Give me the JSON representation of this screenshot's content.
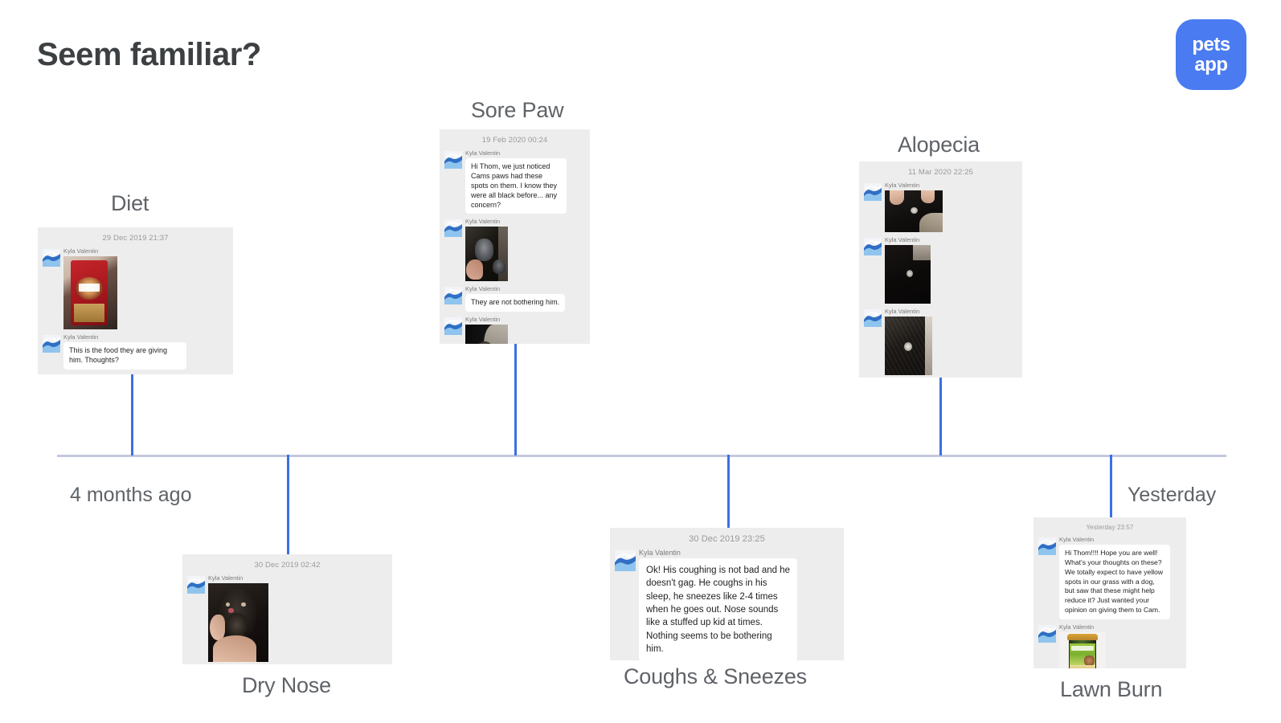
{
  "page": {
    "title": "Seem familiar?"
  },
  "logo": {
    "line1": "pets",
    "line2": "app"
  },
  "timeline": {
    "start_label": "4 months ago",
    "end_label": "Yesterday"
  },
  "events": [
    {
      "id": "diet",
      "title": "Diet",
      "timestamp": "29 Dec 2019 21:37",
      "messages": [
        {
          "sender": "Kyla Valentin",
          "type": "photo",
          "photo": "purina-one-dog-food-bag"
        },
        {
          "sender": "Kyla Valentin",
          "type": "text",
          "text": "This is the food they are giving him. Thoughts?"
        }
      ]
    },
    {
      "id": "dry-nose",
      "title": "Dry Nose",
      "timestamp": "30 Dec 2019 02:42",
      "messages": [
        {
          "sender": "Kyla Valentin",
          "type": "photo",
          "photo": "black-dog-face-held-in-hands"
        }
      ]
    },
    {
      "id": "sore-paw",
      "title": "Sore Paw",
      "timestamp": "19 Feb 2020 00:24",
      "messages": [
        {
          "sender": "Kyla Valentin",
          "type": "text",
          "text": "Hi Thom, we just noticed Cams paws had these spots on them. I know they were all black before... any concern?"
        },
        {
          "sender": "Kyla Valentin",
          "type": "photo",
          "photo": "dog-paw-pad-closeup"
        },
        {
          "sender": "Kyla Valentin",
          "type": "text",
          "text": "They are not bothering him."
        },
        {
          "sender": "Kyla Valentin",
          "type": "photo",
          "photo": "dog-paw-on-blanket"
        }
      ]
    },
    {
      "id": "coughs-sneezes",
      "title": "Coughs & Sneezes",
      "timestamp": "30 Dec 2019 23:25",
      "messages": [
        {
          "sender": "Kyla Valentin",
          "type": "text",
          "text": "Ok! His coughing is not bad and he doesn't gag. He coughs in his sleep, he sneezes like 2-4 times when he goes out. Nose sounds like a stuffed up kid at times. Nothing seems to be bothering him."
        }
      ]
    },
    {
      "id": "alopecia",
      "title": "Alopecia",
      "timestamp": "11 Mar 2020 22:25",
      "messages": [
        {
          "sender": "Kyla Valentin",
          "type": "photo",
          "photo": "bald-spot-on-black-fur-1"
        },
        {
          "sender": "Kyla Valentin",
          "type": "photo",
          "photo": "bald-spot-on-black-fur-2"
        },
        {
          "sender": "Kyla Valentin",
          "type": "photo",
          "photo": "bald-spot-on-black-fur-3"
        }
      ]
    },
    {
      "id": "lawn-burn",
      "title": "Lawn Burn",
      "timestamp": "Yesterday 23:57",
      "messages": [
        {
          "sender": "Kyla Valentin",
          "type": "text",
          "text": "Hi Thom!!!! Hope you are well! What's your thoughts on these? We totally expect to have yellow spots in our grass with a dog, but saw that these might help reduce it? Just wanted your opinion on giving them to Cam."
        },
        {
          "sender": "Kyla Valentin",
          "type": "photo",
          "photo": "grass-saver-supplement-jar"
        }
      ]
    }
  ],
  "colors": {
    "connector_blue": "#3c6fe3",
    "axis_gray": "#c3c8dd",
    "card_bg": "#ededed",
    "brand_blue": "#4a7bf0",
    "text_gray": "#5f6368"
  }
}
